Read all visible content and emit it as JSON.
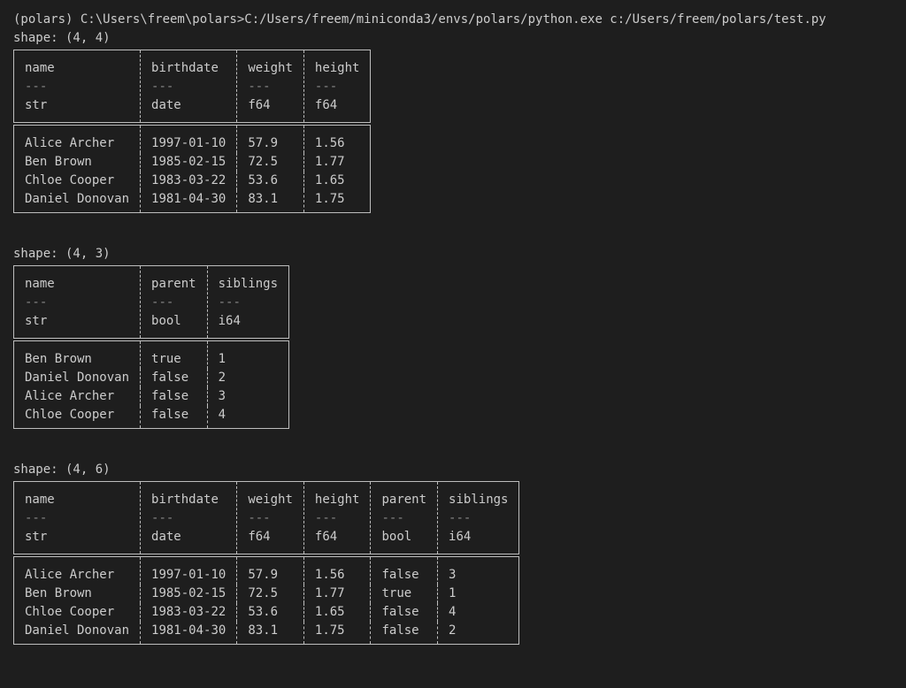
{
  "command": "(polars) C:\\Users\\freem\\polars>C:/Users/freem/miniconda3/envs/polars/python.exe c:/Users/freem/polars/test.py",
  "tables": [
    {
      "shape": "shape: (4, 4)",
      "columns": [
        {
          "name": "name",
          "sep": "---",
          "dtype": "str"
        },
        {
          "name": "birthdate",
          "sep": "---",
          "dtype": "date"
        },
        {
          "name": "weight",
          "sep": "---",
          "dtype": "f64"
        },
        {
          "name": "height",
          "sep": "---",
          "dtype": "f64"
        }
      ],
      "rows": [
        [
          "Alice Archer",
          "1997-01-10",
          "57.9",
          "1.56"
        ],
        [
          "Ben Brown",
          "1985-02-15",
          "72.5",
          "1.77"
        ],
        [
          "Chloe Cooper",
          "1983-03-22",
          "53.6",
          "1.65"
        ],
        [
          "Daniel Donovan",
          "1981-04-30",
          "83.1",
          "1.75"
        ]
      ]
    },
    {
      "shape": "shape: (4, 3)",
      "columns": [
        {
          "name": "name",
          "sep": "---",
          "dtype": "str"
        },
        {
          "name": "parent",
          "sep": "---",
          "dtype": "bool"
        },
        {
          "name": "siblings",
          "sep": "---",
          "dtype": "i64"
        }
      ],
      "rows": [
        [
          "Ben Brown",
          "true",
          "1"
        ],
        [
          "Daniel Donovan",
          "false",
          "2"
        ],
        [
          "Alice Archer",
          "false",
          "3"
        ],
        [
          "Chloe Cooper",
          "false",
          "4"
        ]
      ]
    },
    {
      "shape": "shape: (4, 6)",
      "columns": [
        {
          "name": "name",
          "sep": "---",
          "dtype": "str"
        },
        {
          "name": "birthdate",
          "sep": "---",
          "dtype": "date"
        },
        {
          "name": "weight",
          "sep": "---",
          "dtype": "f64"
        },
        {
          "name": "height",
          "sep": "---",
          "dtype": "f64"
        },
        {
          "name": "parent",
          "sep": "---",
          "dtype": "bool"
        },
        {
          "name": "siblings",
          "sep": "---",
          "dtype": "i64"
        }
      ],
      "rows": [
        [
          "Alice Archer",
          "1997-01-10",
          "57.9",
          "1.56",
          "false",
          "3"
        ],
        [
          "Ben Brown",
          "1985-02-15",
          "72.5",
          "1.77",
          "true",
          "1"
        ],
        [
          "Chloe Cooper",
          "1983-03-22",
          "53.6",
          "1.65",
          "false",
          "4"
        ],
        [
          "Daniel Donovan",
          "1981-04-30",
          "83.1",
          "1.75",
          "false",
          "2"
        ]
      ]
    }
  ]
}
